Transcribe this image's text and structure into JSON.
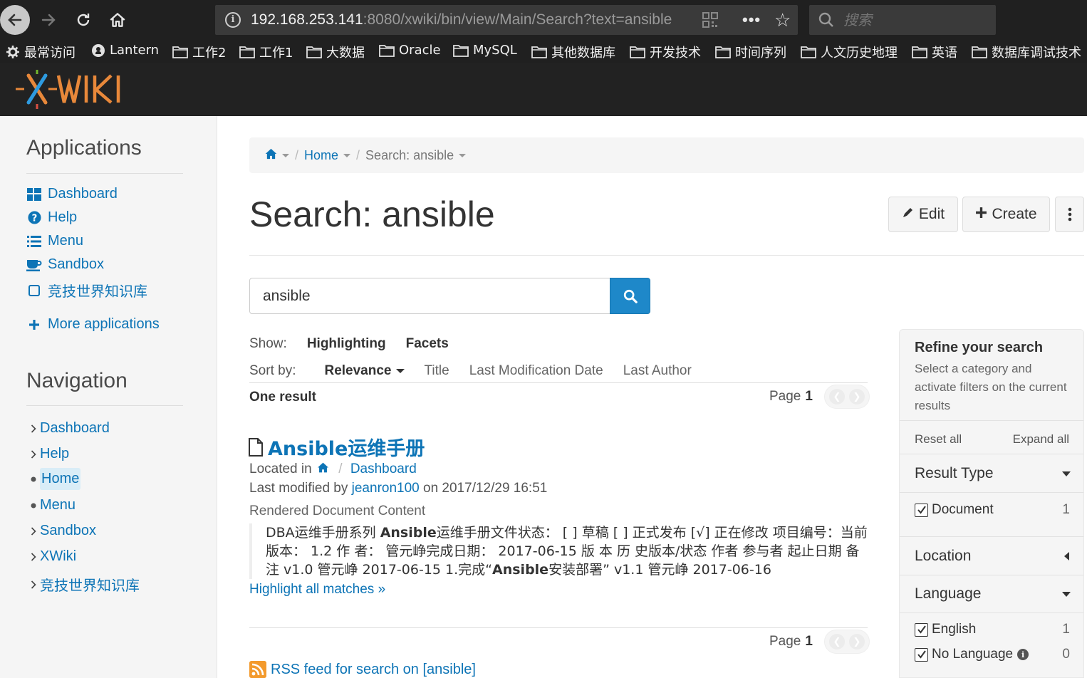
{
  "browser": {
    "url_host": "192.168.253.141",
    "url_rest": ":8080/xwiki/bin/view/Main/Search?text=ansible",
    "search_placeholder": "搜索",
    "bookmarks": [
      "最常访问",
      "Lantern",
      "工作2",
      "工作1",
      "大数据",
      "Oracle",
      "MySQL",
      "其他数据库",
      "开发技术",
      "时间序列",
      "人文历史地理",
      "英语",
      "数据库调试技术"
    ]
  },
  "sidebar": {
    "applications_title": "Applications",
    "apps": [
      {
        "label": "Dashboard",
        "icon": "dashboard-icon"
      },
      {
        "label": "Help",
        "icon": "question-circle-icon"
      },
      {
        "label": "Menu",
        "icon": "list-icon"
      },
      {
        "label": "Sandbox",
        "icon": "coffee-icon"
      },
      {
        "label": "竞技世界知识库",
        "icon": "square-icon"
      }
    ],
    "more_apps": "More applications",
    "navigation_title": "Navigation",
    "nav": [
      {
        "label": "Dashboard",
        "marker": "chevron-right"
      },
      {
        "label": "Help",
        "marker": "chevron-right"
      },
      {
        "label": "Home",
        "marker": "bullet",
        "current": true
      },
      {
        "label": "Menu",
        "marker": "bullet"
      },
      {
        "label": "Sandbox",
        "marker": "chevron-right"
      },
      {
        "label": "XWiki",
        "marker": "chevron-right"
      },
      {
        "label": "竞技世界知识库",
        "marker": "chevron-right"
      }
    ]
  },
  "breadcrumb": {
    "home": "Home",
    "current": "Search: ansible"
  },
  "page": {
    "title": "Search: ansible",
    "edit": "Edit",
    "create": "Create"
  },
  "search": {
    "query": "ansible",
    "show_label": "Show:",
    "show_options": [
      "Highlighting",
      "Facets"
    ],
    "sort_label": "Sort by:",
    "sort_options": [
      "Relevance",
      "Title",
      "Last Modification Date",
      "Last Author"
    ],
    "result_count": "One result",
    "page_label": "Page",
    "page_number": "1"
  },
  "result": {
    "title": "Ansible运维手册",
    "located_label": "Located in",
    "located_in": "Dashboard",
    "modified_prefix": "Last modified by",
    "author": "jeanron100",
    "modified_suffix": "on 2017/12/29 16:51",
    "content_label": "Rendered Document Content",
    "snippet_1": "DBA运维手册系列 ",
    "snippet_hl_1": "Ansible",
    "snippet_2": "运维手册文件状态： [ ] 草稿 [ ] 正式发布 [√] 正在修改 项目编号：当前版本： 1.2 作 者： 管元峥完成日期： 2017-06-15 版 本 历 史版本/状态 作者 参与者 起止日期 备注 v1.0 管元峥 2017-06-15 1.完成“",
    "snippet_hl_2": "Ansible",
    "snippet_3": "安装部署” v1.1 管元峥 2017-06-16",
    "highlight_all": "Highlight all matches »"
  },
  "rss": "RSS feed for search on [ansible]",
  "facets": {
    "title": "Refine your search",
    "description": "Select a category and activate filters on the current results",
    "reset_all": "Reset all",
    "expand_all": "Expand all",
    "result_type": "Result Type",
    "result_type_items": [
      {
        "label": "Document",
        "count": "1"
      }
    ],
    "location": "Location",
    "language": "Language",
    "language_items": [
      {
        "label": "English",
        "count": "1"
      },
      {
        "label": "No Language",
        "count": "0"
      }
    ]
  },
  "colors": {
    "link": "#0d74b6",
    "header": "#222222",
    "search_button": "#1e88c9"
  }
}
